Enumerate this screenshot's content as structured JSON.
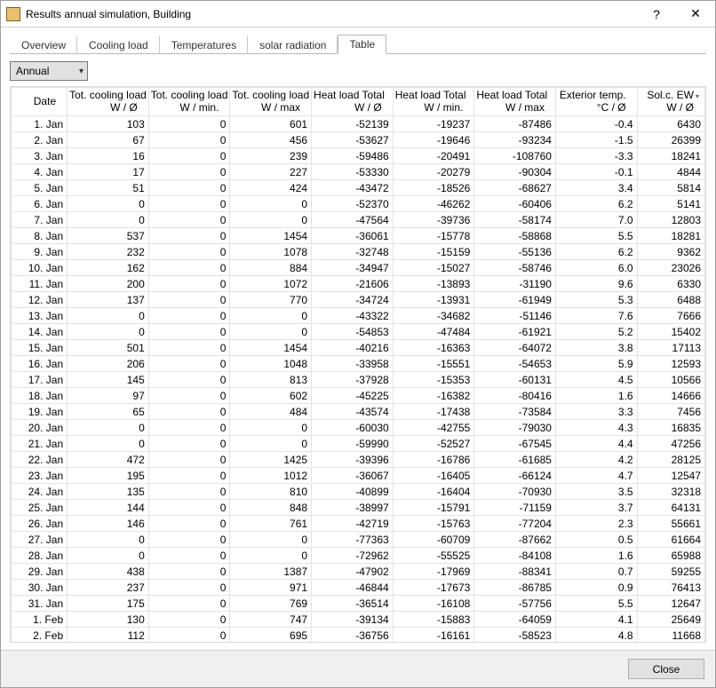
{
  "window": {
    "title": "Results annual simulation, Building",
    "help": "?",
    "close": "✕"
  },
  "tabs": [
    "Overview",
    "Cooling load",
    "Temperatures",
    "solar radiation",
    "Table"
  ],
  "active_tab": 4,
  "period_select": {
    "value": "Annual"
  },
  "columns": [
    {
      "l1": "",
      "l2": "Date"
    },
    {
      "l1": "Tot. cooling load",
      "l2": "W / Ø"
    },
    {
      "l1": "Tot. cooling load",
      "l2": "W / min."
    },
    {
      "l1": "Tot. cooling load",
      "l2": "W / max"
    },
    {
      "l1": "Heat load Total",
      "l2": "W / Ø"
    },
    {
      "l1": "Heat load Total",
      "l2": "W / min."
    },
    {
      "l1": "Heat load Total",
      "l2": "W / max"
    },
    {
      "l1": "Exterior temp.",
      "l2": "°C / Ø"
    },
    {
      "l1": "Sol.c. EW",
      "l2": "W / Ø"
    }
  ],
  "rows": [
    {
      "date": "1. Jan",
      "c1": 103,
      "c2": 0,
      "c3": 601,
      "c4": -52139,
      "c5": -19237,
      "c6": -87486,
      "c7": "-0.4",
      "c8": 6430
    },
    {
      "date": "2. Jan",
      "c1": 67,
      "c2": 0,
      "c3": 456,
      "c4": -53627,
      "c5": -19646,
      "c6": -93234,
      "c7": "-1.5",
      "c8": 26399
    },
    {
      "date": "3. Jan",
      "c1": 16,
      "c2": 0,
      "c3": 239,
      "c4": -59486,
      "c5": -20491,
      "c6": -108760,
      "c7": "-3.3",
      "c8": 18241
    },
    {
      "date": "4. Jan",
      "c1": 17,
      "c2": 0,
      "c3": 227,
      "c4": -53330,
      "c5": -20279,
      "c6": -90304,
      "c7": "-0.1",
      "c8": 4844
    },
    {
      "date": "5. Jan",
      "c1": 51,
      "c2": 0,
      "c3": 424,
      "c4": -43472,
      "c5": -18526,
      "c6": -68627,
      "c7": "3.4",
      "c8": 5814
    },
    {
      "date": "6. Jan",
      "c1": 0,
      "c2": 0,
      "c3": 0,
      "c4": -52370,
      "c5": -46262,
      "c6": -60406,
      "c7": "6.2",
      "c8": 5141
    },
    {
      "date": "7. Jan",
      "c1": 0,
      "c2": 0,
      "c3": 0,
      "c4": -47564,
      "c5": -39736,
      "c6": -58174,
      "c7": "7.0",
      "c8": 12803
    },
    {
      "date": "8. Jan",
      "c1": 537,
      "c2": 0,
      "c3": 1454,
      "c4": -36061,
      "c5": -15778,
      "c6": -58868,
      "c7": "5.5",
      "c8": 18281
    },
    {
      "date": "9. Jan",
      "c1": 232,
      "c2": 0,
      "c3": 1078,
      "c4": -32748,
      "c5": -15159,
      "c6": -55136,
      "c7": "6.2",
      "c8": 9362
    },
    {
      "date": "10. Jan",
      "c1": 162,
      "c2": 0,
      "c3": 884,
      "c4": -34947,
      "c5": -15027,
      "c6": -58746,
      "c7": "6.0",
      "c8": 23026
    },
    {
      "date": "11. Jan",
      "c1": 200,
      "c2": 0,
      "c3": 1072,
      "c4": -21606,
      "c5": -13893,
      "c6": -31190,
      "c7": "9.6",
      "c8": 6330
    },
    {
      "date": "12. Jan",
      "c1": 137,
      "c2": 0,
      "c3": 770,
      "c4": -34724,
      "c5": -13931,
      "c6": -61949,
      "c7": "5.3",
      "c8": 6488
    },
    {
      "date": "13. Jan",
      "c1": 0,
      "c2": 0,
      "c3": 0,
      "c4": -43322,
      "c5": -34682,
      "c6": -51146,
      "c7": "7.6",
      "c8": 7666
    },
    {
      "date": "14. Jan",
      "c1": 0,
      "c2": 0,
      "c3": 0,
      "c4": -54853,
      "c5": -47484,
      "c6": -61921,
      "c7": "5.2",
      "c8": 15402
    },
    {
      "date": "15. Jan",
      "c1": 501,
      "c2": 0,
      "c3": 1454,
      "c4": -40216,
      "c5": -16363,
      "c6": -64072,
      "c7": "3.8",
      "c8": 17113
    },
    {
      "date": "16. Jan",
      "c1": 206,
      "c2": 0,
      "c3": 1048,
      "c4": -33958,
      "c5": -15551,
      "c6": -54653,
      "c7": "5.9",
      "c8": 12593
    },
    {
      "date": "17. Jan",
      "c1": 145,
      "c2": 0,
      "c3": 813,
      "c4": -37928,
      "c5": -15353,
      "c6": -60131,
      "c7": "4.5",
      "c8": 10566
    },
    {
      "date": "18. Jan",
      "c1": 97,
      "c2": 0,
      "c3": 602,
      "c4": -45225,
      "c5": -16382,
      "c6": -80416,
      "c7": "1.6",
      "c8": 14666
    },
    {
      "date": "19. Jan",
      "c1": 65,
      "c2": 0,
      "c3": 484,
      "c4": -43574,
      "c5": -17438,
      "c6": -73584,
      "c7": "3.3",
      "c8": 7456
    },
    {
      "date": "20. Jan",
      "c1": 0,
      "c2": 0,
      "c3": 0,
      "c4": -60030,
      "c5": -42755,
      "c6": -79030,
      "c7": "4.3",
      "c8": 16835
    },
    {
      "date": "21. Jan",
      "c1": 0,
      "c2": 0,
      "c3": 0,
      "c4": -59990,
      "c5": -52527,
      "c6": -67545,
      "c7": "4.4",
      "c8": 47256
    },
    {
      "date": "22. Jan",
      "c1": 472,
      "c2": 0,
      "c3": 1425,
      "c4": -39396,
      "c5": -16786,
      "c6": -61685,
      "c7": "4.2",
      "c8": 28125
    },
    {
      "date": "23. Jan",
      "c1": 195,
      "c2": 0,
      "c3": 1012,
      "c4": -36067,
      "c5": -16405,
      "c6": -66124,
      "c7": "4.7",
      "c8": 12547
    },
    {
      "date": "24. Jan",
      "c1": 135,
      "c2": 0,
      "c3": 810,
      "c4": -40899,
      "c5": -16404,
      "c6": -70930,
      "c7": "3.5",
      "c8": 32318
    },
    {
      "date": "25. Jan",
      "c1": 144,
      "c2": 0,
      "c3": 848,
      "c4": -38997,
      "c5": -15791,
      "c6": -71159,
      "c7": "3.7",
      "c8": 64131
    },
    {
      "date": "26. Jan",
      "c1": 146,
      "c2": 0,
      "c3": 761,
      "c4": -42719,
      "c5": -15763,
      "c6": -77204,
      "c7": "2.3",
      "c8": 55661
    },
    {
      "date": "27. Jan",
      "c1": 0,
      "c2": 0,
      "c3": 0,
      "c4": -77363,
      "c5": -60709,
      "c6": -87662,
      "c7": "0.5",
      "c8": 61664
    },
    {
      "date": "28. Jan",
      "c1": 0,
      "c2": 0,
      "c3": 0,
      "c4": -72962,
      "c5": -55525,
      "c6": -84108,
      "c7": "1.6",
      "c8": 65988
    },
    {
      "date": "29. Jan",
      "c1": 438,
      "c2": 0,
      "c3": 1387,
      "c4": -47902,
      "c5": -17969,
      "c6": -88341,
      "c7": "0.7",
      "c8": 59255
    },
    {
      "date": "30. Jan",
      "c1": 237,
      "c2": 0,
      "c3": 971,
      "c4": -46844,
      "c5": -17673,
      "c6": -86785,
      "c7": "0.9",
      "c8": 76413
    },
    {
      "date": "31. Jan",
      "c1": 175,
      "c2": 0,
      "c3": 769,
      "c4": -36514,
      "c5": -16108,
      "c6": -57756,
      "c7": "5.5",
      "c8": 12647
    },
    {
      "date": "1. Feb",
      "c1": 130,
      "c2": 0,
      "c3": 747,
      "c4": -39134,
      "c5": -15883,
      "c6": -64059,
      "c7": "4.1",
      "c8": 25649
    },
    {
      "date": "2. Feb",
      "c1": 112,
      "c2": 0,
      "c3": 695,
      "c4": -36756,
      "c5": -16161,
      "c6": -58523,
      "c7": "4.8",
      "c8": 11668
    }
  ],
  "footer": {
    "close": "Close"
  }
}
